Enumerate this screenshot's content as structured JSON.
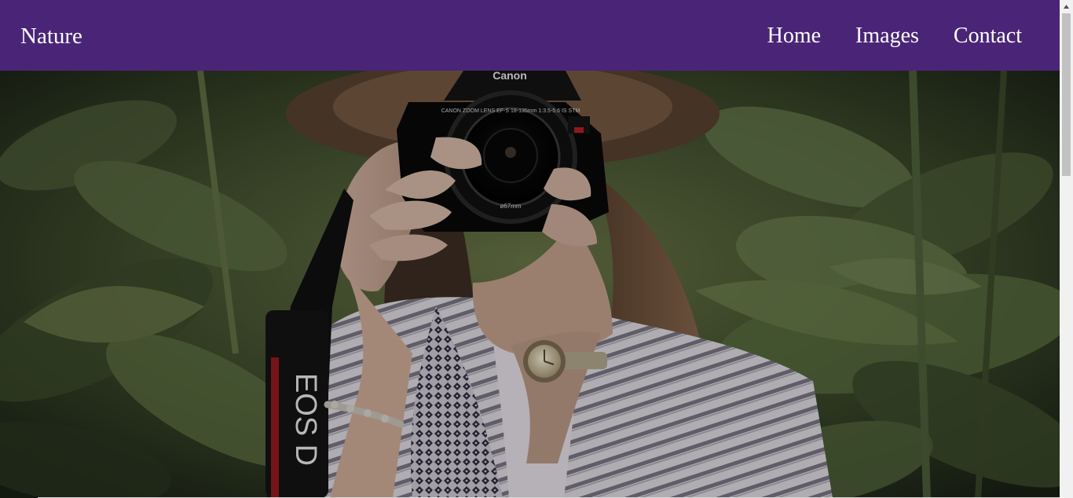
{
  "navbar": {
    "brand": "Nature",
    "links": [
      {
        "label": "Home"
      },
      {
        "label": "Images"
      },
      {
        "label": "Contact"
      }
    ],
    "background": "#4a2577"
  },
  "hero": {
    "camera_brand": "Canon",
    "lens_text": "CANON ZOOM LENS EF-S 18-135mm 1:3.5-5.6 IS STM",
    "filter_size": "ø67mm",
    "strap_text": "EOS D"
  }
}
